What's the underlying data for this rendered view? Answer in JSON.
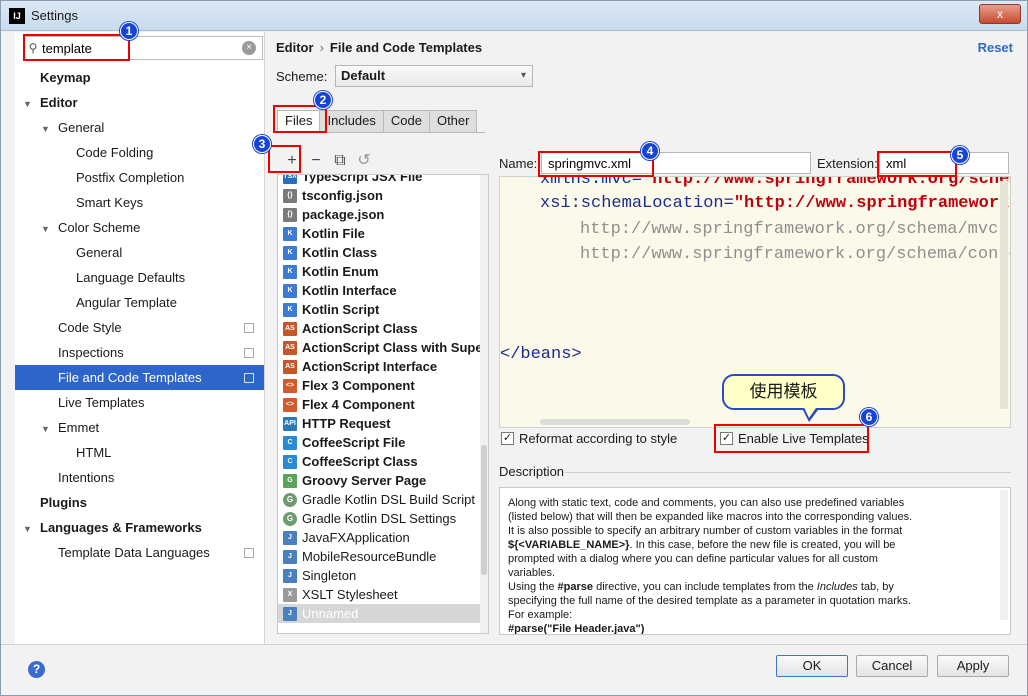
{
  "window": {
    "title": "Settings",
    "app_icon": "IJ",
    "close": "x"
  },
  "search": {
    "value": "template",
    "clear": "×"
  },
  "tree": [
    {
      "label": "Keymap",
      "level": 0,
      "bold": true
    },
    {
      "label": "Editor",
      "level": 0,
      "bold": true,
      "arrow": "▼"
    },
    {
      "label": "General",
      "level": 1,
      "arrow": "▼"
    },
    {
      "label": "Code Folding",
      "level": 2
    },
    {
      "label": "Postfix Completion",
      "level": 2
    },
    {
      "label": "Smart Keys",
      "level": 2
    },
    {
      "label": "Color Scheme",
      "level": 1,
      "arrow": "▼"
    },
    {
      "label": "General",
      "level": 2
    },
    {
      "label": "Language Defaults",
      "level": 2
    },
    {
      "label": "Angular Template",
      "level": 2
    },
    {
      "label": "Code Style",
      "level": 1,
      "copy": true
    },
    {
      "label": "Inspections",
      "level": 1,
      "copy": true
    },
    {
      "label": "File and Code Templates",
      "level": 1,
      "copy": true,
      "selected": true
    },
    {
      "label": "Live Templates",
      "level": 1
    },
    {
      "label": "Emmet",
      "level": 1,
      "arrow": "▼"
    },
    {
      "label": "HTML",
      "level": 2
    },
    {
      "label": "Intentions",
      "level": 1
    },
    {
      "label": "Plugins",
      "level": 0,
      "bold": true
    },
    {
      "label": "Languages & Frameworks",
      "level": 0,
      "bold": true,
      "arrow": "▼"
    },
    {
      "label": "Template Data Languages",
      "level": 1,
      "copy": true
    }
  ],
  "breadcrumb": {
    "parent": "Editor",
    "separator": "›",
    "current": "File and Code Templates"
  },
  "reset": "Reset",
  "scheme": {
    "label": "Scheme:",
    "value": "Default",
    "chevron": "▾"
  },
  "tabs": [
    {
      "label": "Files",
      "active": true
    },
    {
      "label": "Includes"
    },
    {
      "label": "Code"
    },
    {
      "label": "Other"
    }
  ],
  "toolbar": {
    "add": "+",
    "remove": "−",
    "copy": "⧉",
    "reset": "↺"
  },
  "templates": [
    {
      "label": "TypeScript JSX File",
      "icon": "TSX",
      "color": "#2a6fbd"
    },
    {
      "label": "tsconfig.json",
      "icon": "{}",
      "color": "#7a7a7a"
    },
    {
      "label": "package.json",
      "icon": "{}",
      "color": "#7a7a7a"
    },
    {
      "label": "Kotlin File",
      "icon": "K",
      "color": "#3c7ad6"
    },
    {
      "label": "Kotlin Class",
      "icon": "K",
      "color": "#3c7ad6"
    },
    {
      "label": "Kotlin Enum",
      "icon": "K",
      "color": "#3c7ad6"
    },
    {
      "label": "Kotlin Interface",
      "icon": "K",
      "color": "#3c7ad6"
    },
    {
      "label": "Kotlin Script",
      "icon": "K",
      "color": "#3c7ad6"
    },
    {
      "label": "ActionScript Class",
      "icon": "AS",
      "color": "#c4572a"
    },
    {
      "label": "ActionScript Class with Supers",
      "icon": "AS",
      "color": "#c4572a"
    },
    {
      "label": "ActionScript Interface",
      "icon": "AS",
      "color": "#c4572a"
    },
    {
      "label": "Flex 3 Component",
      "icon": "<>",
      "color": "#d25a2b"
    },
    {
      "label": "Flex 4 Component",
      "icon": "<>",
      "color": "#d25a2b"
    },
    {
      "label": "HTTP Request",
      "icon": "API",
      "color": "#2d79b7"
    },
    {
      "label": "CoffeeScript File",
      "icon": "C",
      "color": "#2c8ad4"
    },
    {
      "label": "CoffeeScript Class",
      "icon": "C",
      "color": "#2c8ad4"
    },
    {
      "label": "Groovy Server Page",
      "icon": "G",
      "color": "#5aa35a"
    },
    {
      "label": "Gradle Kotlin DSL Build Script",
      "icon": "G",
      "color": "#6e9c6e",
      "normal": true,
      "round": true
    },
    {
      "label": "Gradle Kotlin DSL Settings",
      "icon": "G",
      "color": "#6e9c6e",
      "normal": true,
      "round": true
    },
    {
      "label": "JavaFXApplication",
      "icon": "J",
      "color": "#4a7fc0",
      "normal": true
    },
    {
      "label": "MobileResourceBundle",
      "icon": "J",
      "color": "#4a7fc0",
      "normal": true
    },
    {
      "label": "Singleton",
      "icon": "J",
      "color": "#4a7fc0",
      "normal": true
    },
    {
      "label": "XSLT Stylesheet",
      "icon": "X",
      "color": "#9a9a9a",
      "normal": true
    },
    {
      "label": "Unnamed",
      "icon": "J",
      "color": "#4a7fc0",
      "unnamed": true
    }
  ],
  "name_field": {
    "label": "Name:",
    "value": "springmvc.xml"
  },
  "ext_field": {
    "label": "Extension:",
    "value": "xml"
  },
  "code": {
    "line1_attr": "xmlns:mvc=",
    "line1_val": "\"http://www.springframework.org/schem",
    "line2_attr": "xsi:schemaLocation=",
    "line2_val": "\"http://www.springframework.",
    "line3": "http://www.springframework.org/schema/mvc h",
    "line4": "http://www.springframework.org/schema/conte",
    "line5": "</beans>"
  },
  "options": {
    "reformat": "Reformat according to style",
    "live_templates": "Enable Live Templates",
    "check": "✓"
  },
  "description": {
    "label": "Description",
    "l1": "Along with static text, code and comments, you can also use predefined variables",
    "l2": "(listed below) that will then be expanded like macros into the corresponding values.",
    "l3": "It is also possible to specify an arbitrary number of custom variables in the format",
    "l4a": "${<VARIABLE_NAME>}",
    "l4b": ". In this case, before the new file is created, you will be",
    "l5": "prompted with a dialog where you can define particular values for all custom",
    "l6": "variables.",
    "l7a": "Using the ",
    "l7b": "#parse",
    "l7c": " directive, you can include templates from the ",
    "l7d": "Includes",
    "l7e": " tab, by",
    "l8": "specifying the full name of the desired template as a parameter in quotation marks.",
    "l9": "For example:",
    "l10": "#parse(\"File Header.java\")"
  },
  "callout": {
    "text": "使用模板"
  },
  "badges": [
    "1",
    "2",
    "3",
    "4",
    "5",
    "6"
  ],
  "footer": {
    "help": "?",
    "ok": "OK",
    "cancel": "Cancel",
    "apply": "Apply"
  },
  "colors": {
    "selection": "#2e65ca",
    "link": "#2b6cc4",
    "annotation_red": "#e00000",
    "badge_blue": "#1744d8"
  }
}
